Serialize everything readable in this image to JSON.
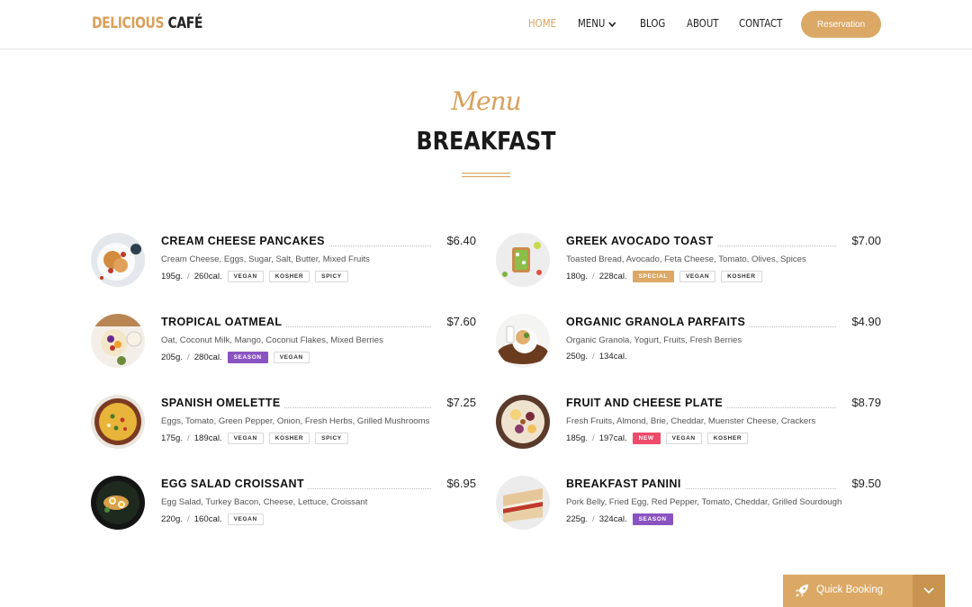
{
  "header": {
    "logo_part1": "DELICIOUS",
    "logo_part2": "CAFÉ",
    "nav": [
      "HOME",
      "MENU",
      "BLOG",
      "ABOUT",
      "CONTACT"
    ],
    "active_nav": "HOME",
    "reservation_label": "Reservation"
  },
  "hero": {
    "script_title": "Menu",
    "title": "BREAKFAST"
  },
  "menu_items": [
    {
      "name": "CREAM CHEESE PANCAKES",
      "price": "$6.40",
      "description": "Cream Cheese, Eggs, Sugar, Salt, Butter, Mixed Fruits",
      "weight": "195g.",
      "calories": "260cal.",
      "tags": [
        "VEGAN",
        "KOSHER",
        "SPICY"
      ],
      "photo_icon": "pancakes-photo"
    },
    {
      "name": "GREEK AVOCADO TOAST",
      "price": "$7.00",
      "description": "Toasted Bread, Avocado, Feta Cheese, Tomato, Olives, Spices",
      "weight": "180g.",
      "calories": "228cal.",
      "tags": [
        "SPECIAL",
        "VEGAN",
        "KOSHER"
      ],
      "photo_icon": "avocado-toast-photo"
    },
    {
      "name": "TROPICAL OATMEAL",
      "price": "$7.60",
      "description": "Oat, Coconut Milk, Mango, Coconut Flakes, Mixed Berries",
      "weight": "205g.",
      "calories": "280cal.",
      "tags": [
        "SEASON",
        "VEGAN"
      ],
      "photo_icon": "oatmeal-photo"
    },
    {
      "name": "ORGANIC GRANOLA PARFAITS",
      "price": "$4.90",
      "description": "Organic Granola, Yogurt, Fruits, Fresh Berries",
      "weight": "250g.",
      "calories": "134cal.",
      "tags": [],
      "photo_icon": "granola-photo"
    },
    {
      "name": "SPANISH OMELETTE",
      "price": "$7.25",
      "description": "Eggs, Tomato, Green Pepper, Onion, Fresh Herbs, Grilled Mushrooms",
      "weight": "175g.",
      "calories": "189cal.",
      "tags": [
        "VEGAN",
        "KOSHER",
        "SPICY"
      ],
      "photo_icon": "omelette-photo"
    },
    {
      "name": "FRUIT AND CHEESE PLATE",
      "price": "$8.79",
      "description": "Fresh Fruits, Almond, Brie, Cheddar, Muenster Cheese, Crackers",
      "weight": "185g.",
      "calories": "197cal.",
      "tags": [
        "NEW",
        "VEGAN",
        "KOSHER"
      ],
      "photo_icon": "cheese-plate-photo"
    },
    {
      "name": "EGG SALAD CROISSANT",
      "price": "$6.95",
      "description": "Egg Salad, Turkey Bacon, Cheese, Lettuce, Croissant",
      "weight": "220g.",
      "calories": "160cal.",
      "tags": [
        "VEGAN"
      ],
      "photo_icon": "croissant-photo"
    },
    {
      "name": "BREAKFAST PANINI",
      "price": "$9.50",
      "description": "Pork Belly, Fried Egg, Red Pepper, Tomato, Cheddar, Grilled Sourdough",
      "weight": "225g.",
      "calories": "324cal.",
      "tags": [
        "SEASON"
      ],
      "photo_icon": "panini-photo"
    }
  ],
  "quick_booking": {
    "label": "Quick Booking",
    "icon": "rocket-icon",
    "toggle_icon": "chevron-down-icon"
  },
  "colors": {
    "accent": "#dba865",
    "season": "#8a53c2",
    "new": "#ef4b6a"
  }
}
